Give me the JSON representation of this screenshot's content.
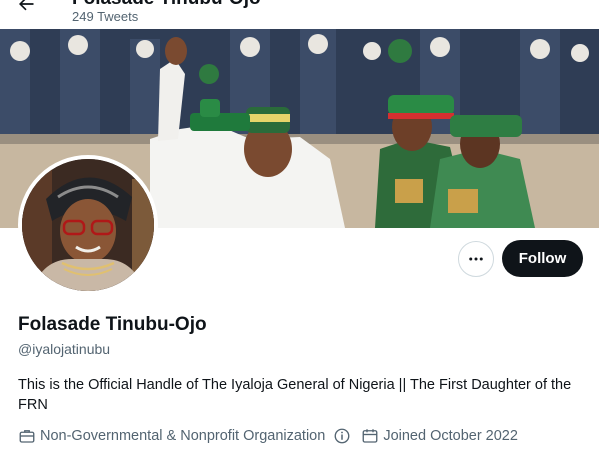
{
  "header": {
    "name": "Folasade Tinubu-Ojo",
    "tweet_count": "249 Tweets"
  },
  "profile": {
    "display_name": "Folasade Tinubu-Ojo",
    "handle": "@iyalojatinubu",
    "bio": "This is the Official Handle of The Iyaloja General of Nigeria || The First Daughter of the FRN",
    "category": "Non-Governmental & Nonprofit Organization",
    "joined": "Joined October 2022"
  },
  "actions": {
    "follow_label": "Follow"
  },
  "icons": {
    "back": "arrow-left-icon",
    "more": "more-horizontal-icon",
    "category": "briefcase-icon",
    "info": "info-circle-icon",
    "calendar": "calendar-icon"
  },
  "colors": {
    "text_primary": "#0f1419",
    "text_secondary": "#536471",
    "follow_bg": "#0f1419",
    "follow_text": "#ffffff",
    "border": "#cfd9de"
  }
}
